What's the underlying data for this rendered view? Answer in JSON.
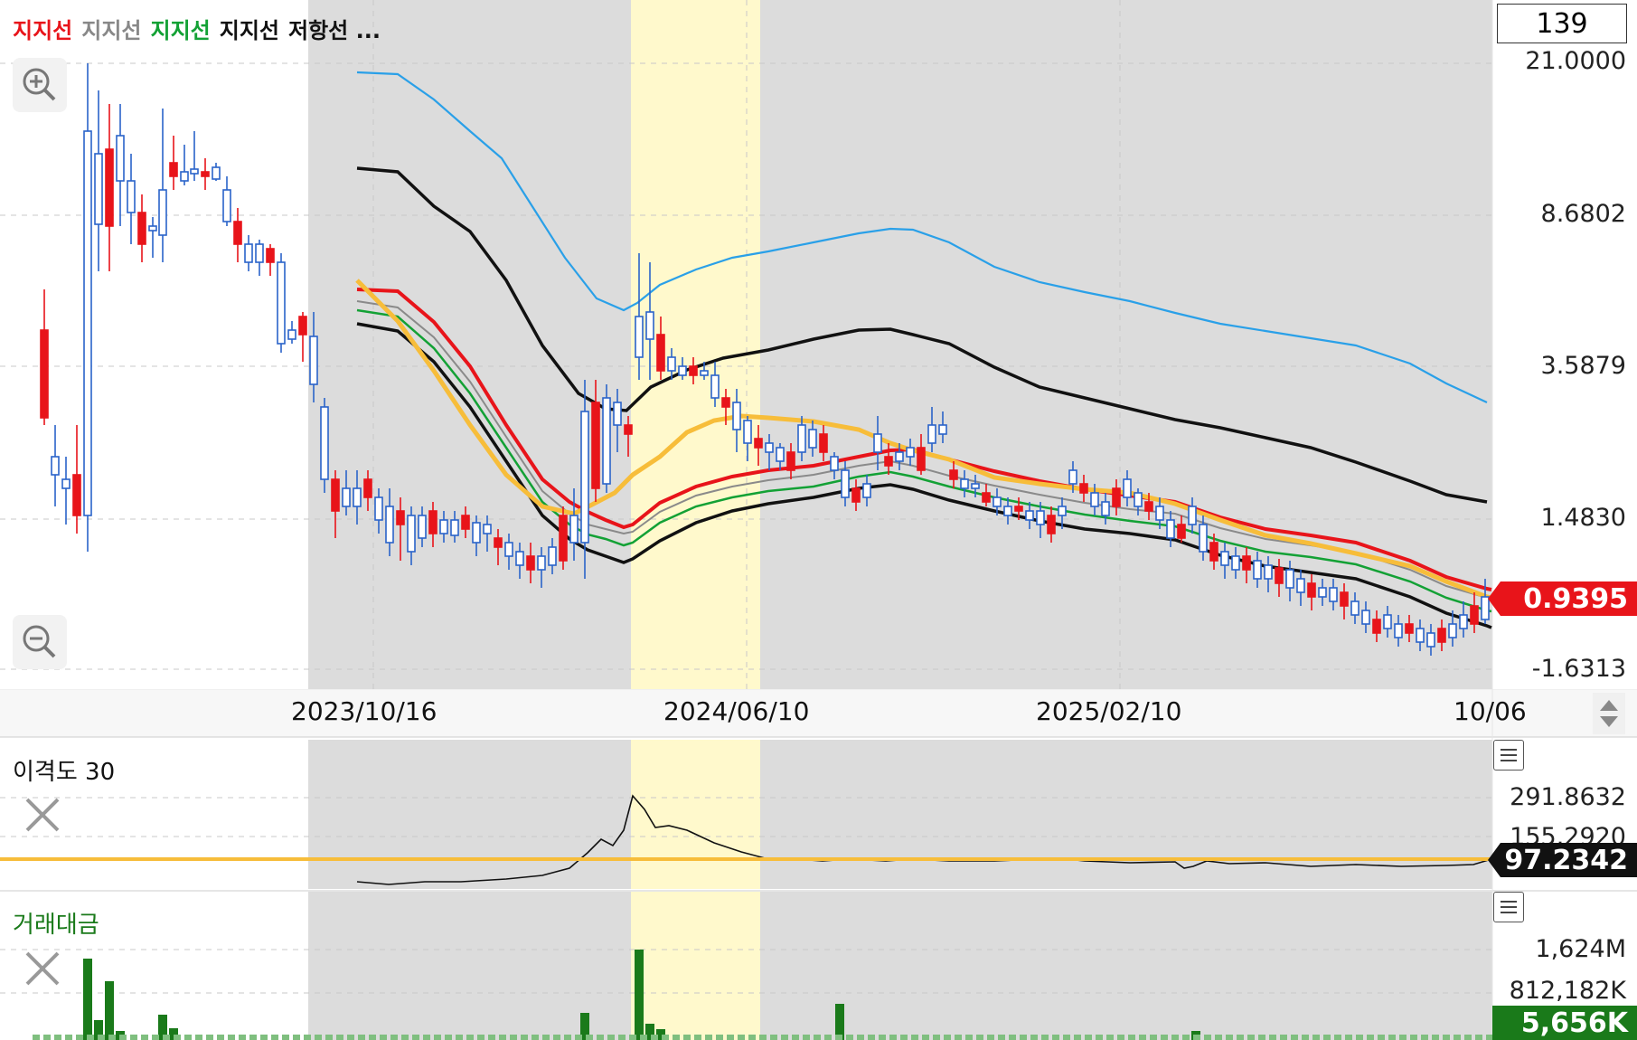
{
  "legend": [
    {
      "label": "지지선",
      "color": "#e8141a"
    },
    {
      "label": "지지선",
      "color": "#888888"
    },
    {
      "label": "지지선",
      "color": "#13a135"
    },
    {
      "label": "지지선",
      "color": "#111111"
    },
    {
      "label": "저항선 ...",
      "color": "#111111"
    }
  ],
  "top_counter": "139",
  "price_axis": [
    "21.0000",
    "8.6802",
    "3.5879",
    "1.4830",
    "-1.6313"
  ],
  "current_price": "0.9395",
  "current_price_color": "#e8141a",
  "date_axis": [
    "2023/10/16",
    "2024/06/10",
    "2025/02/10",
    "10/06"
  ],
  "disparity_panel": {
    "title": "이격도 30",
    "axis": [
      "291.8632",
      "155.2920"
    ],
    "current": "97.2342"
  },
  "volume_panel": {
    "title": "거래대금",
    "title_color": "#1a7a1a",
    "axis": [
      "1,624M",
      "812,182K"
    ],
    "current": "5,656K",
    "current_color": "#1a7a1a"
  },
  "icons": {
    "zoom_in": "zoom-in-icon",
    "zoom_out": "zoom-out-icon",
    "scroll": "up-down-arrow-icon",
    "menu": "hamburger-menu-icon",
    "close": "close-x-icon"
  },
  "colors": {
    "up_candle": "#e8141a",
    "down_candle": "#2a63c9",
    "upper_band": "#2aa0e8",
    "orange_line": "#f7bd3a",
    "highlight_band": "#fff9cc",
    "shaded_region": "#dcdcdc"
  }
}
